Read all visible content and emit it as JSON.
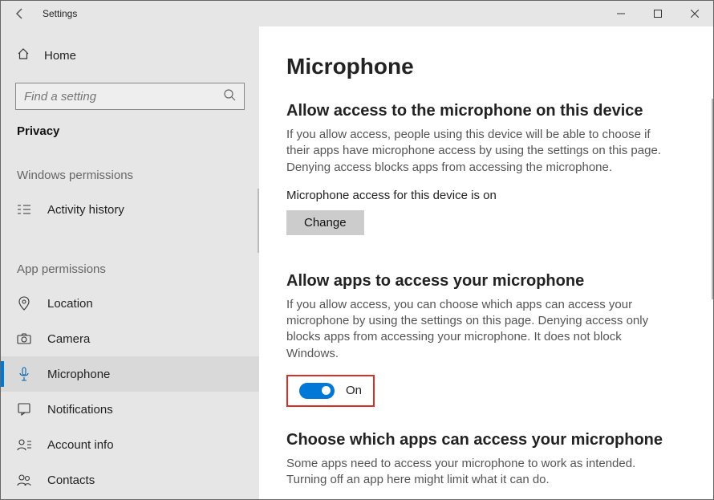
{
  "titlebar": {
    "title": "Settings"
  },
  "sidebar": {
    "home": "Home",
    "search_placeholder": "Find a setting",
    "crumb": "Privacy",
    "group1": "Windows permissions",
    "group2": "App permissions",
    "items": {
      "activity": "Activity history",
      "location": "Location",
      "camera": "Camera",
      "microphone": "Microphone",
      "notifications": "Notifications",
      "account": "Account info",
      "contacts": "Contacts"
    }
  },
  "main": {
    "h1": "Microphone",
    "s1": {
      "h": "Allow access to the microphone on this device",
      "p": "If you allow access, people using this device will be able to choose if their apps have microphone access by using the settings on this page. Denying access blocks apps from accessing the microphone.",
      "status": "Microphone access for this device is on",
      "btn": "Change"
    },
    "s2": {
      "h": "Allow apps to access your microphone",
      "p": "If you allow access, you can choose which apps can access your microphone by using the settings on this page. Denying access only blocks apps from accessing your microphone. It does not block Windows.",
      "toggle": "On"
    },
    "s3": {
      "h": "Choose which apps can access your microphone",
      "p": "Some apps need to access your microphone to work as intended. Turning off an app here might limit what it can do."
    }
  }
}
